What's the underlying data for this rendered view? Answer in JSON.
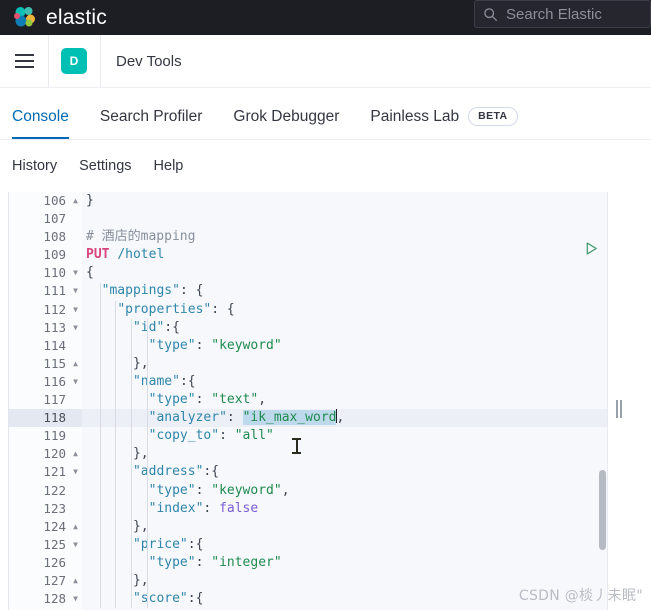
{
  "global_header": {
    "brand_name": "elastic",
    "logo_icon": "elastic-logo-icon",
    "search": {
      "icon": "search-icon",
      "placeholder": "Search Elastic",
      "value": ""
    }
  },
  "app_bar": {
    "menu_icon": "hamburger-menu-icon",
    "avatar_initial": "D",
    "breadcrumb": "Dev Tools"
  },
  "tabs": [
    {
      "label": "Console",
      "active": true,
      "badge": ""
    },
    {
      "label": "Search Profiler",
      "active": false,
      "badge": ""
    },
    {
      "label": "Grok Debugger",
      "active": false,
      "badge": ""
    },
    {
      "label": "Painless Lab",
      "active": false,
      "badge": "BETA"
    }
  ],
  "subnav": [
    {
      "label": "History"
    },
    {
      "label": "Settings"
    },
    {
      "label": "Help"
    }
  ],
  "editor": {
    "actions": {
      "play_icon": "play-request-icon",
      "wrench_icon": "wrench-icon"
    },
    "first_line_number": 106,
    "highlighted_line": 118,
    "selection_text": "\"ik_max_word",
    "lines": [
      {
        "num": 106,
        "fold": "up",
        "indent": 0,
        "text": "}"
      },
      {
        "num": 107,
        "fold": "",
        "indent": 0,
        "text": ""
      },
      {
        "num": 108,
        "fold": "",
        "indent": 0,
        "text": "# 酒店的mapping"
      },
      {
        "num": 109,
        "fold": "",
        "indent": 0,
        "text": "PUT /hotel"
      },
      {
        "num": 110,
        "fold": "down",
        "indent": 0,
        "text": "{"
      },
      {
        "num": 111,
        "fold": "down",
        "indent": 1,
        "text": "\"mappings\": {"
      },
      {
        "num": 112,
        "fold": "down",
        "indent": 2,
        "text": "\"properties\": {"
      },
      {
        "num": 113,
        "fold": "down",
        "indent": 3,
        "text": "\"id\":{"
      },
      {
        "num": 114,
        "fold": "",
        "indent": 4,
        "text": "\"type\": \"keyword\""
      },
      {
        "num": 115,
        "fold": "up",
        "indent": 3,
        "text": "},"
      },
      {
        "num": 116,
        "fold": "down",
        "indent": 3,
        "text": "\"name\":{"
      },
      {
        "num": 117,
        "fold": "",
        "indent": 4,
        "text": "\"type\": \"text\","
      },
      {
        "num": 118,
        "fold": "",
        "indent": 4,
        "text": "\"analyzer\": \"ik_max_word\","
      },
      {
        "num": 119,
        "fold": "",
        "indent": 4,
        "text": "\"copy_to\": \"all\""
      },
      {
        "num": 120,
        "fold": "up",
        "indent": 3,
        "text": "},"
      },
      {
        "num": 121,
        "fold": "down",
        "indent": 3,
        "text": "\"address\":{"
      },
      {
        "num": 122,
        "fold": "",
        "indent": 4,
        "text": "\"type\": \"keyword\","
      },
      {
        "num": 123,
        "fold": "",
        "indent": 4,
        "text": "\"index\": false"
      },
      {
        "num": 124,
        "fold": "up",
        "indent": 3,
        "text": "},"
      },
      {
        "num": 125,
        "fold": "down",
        "indent": 3,
        "text": "\"price\":{"
      },
      {
        "num": 126,
        "fold": "",
        "indent": 4,
        "text": "\"type\": \"integer\""
      },
      {
        "num": 127,
        "fold": "up",
        "indent": 3,
        "text": "},"
      },
      {
        "num": 128,
        "fold": "down",
        "indent": 3,
        "text": "\"score\":{"
      }
    ]
  },
  "watermark": "CSDN @棪丿未眠\"",
  "colors": {
    "brand_teal": "#00bfb3",
    "accent_blue": "#006bb4",
    "header_dark": "#1d1e24",
    "editor_bg": "#f7f8fc",
    "selection": "#bfd9ec",
    "string_green": "#1e8b4d",
    "key_blue": "#2e86ab",
    "method_pink": "#d9447e"
  }
}
